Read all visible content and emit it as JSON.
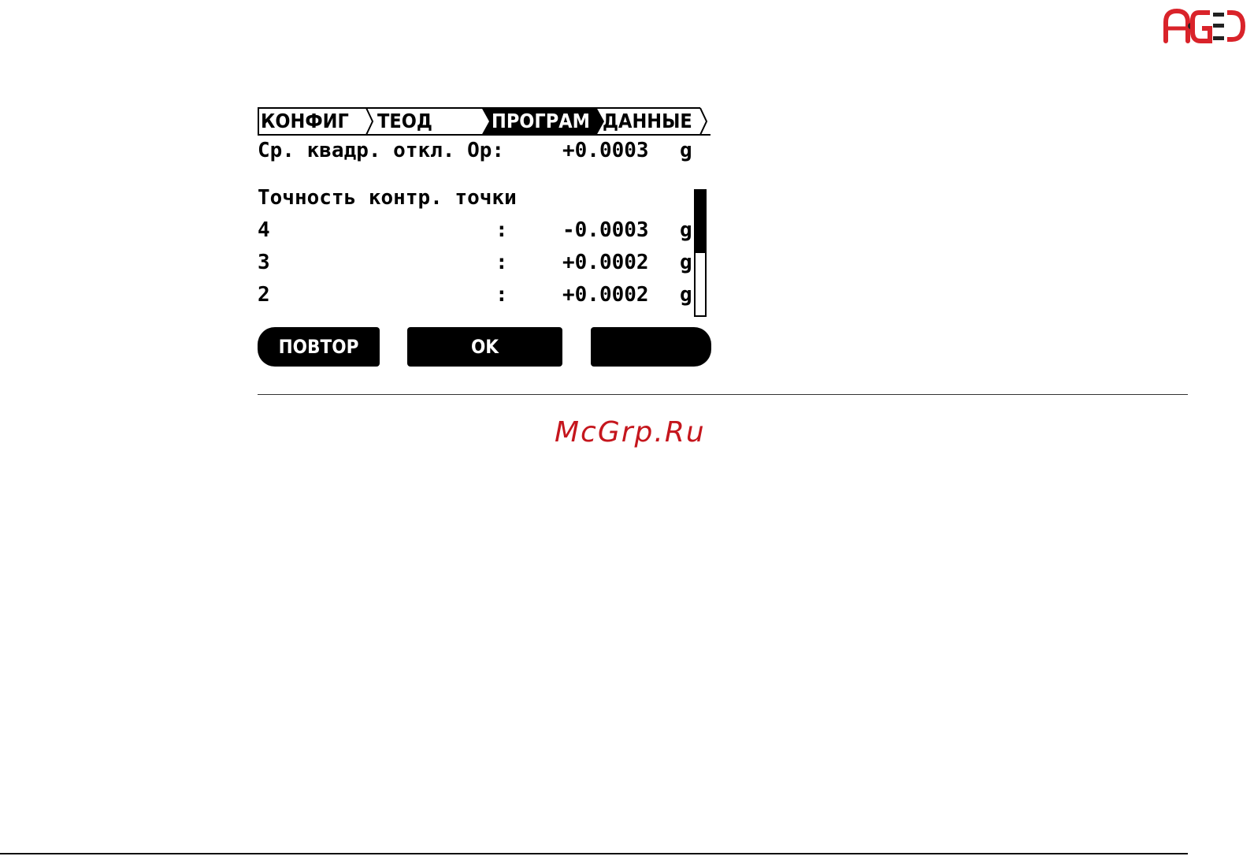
{
  "brand": {
    "logo_text": "AGED",
    "logo_color": "#d9232a"
  },
  "screen": {
    "tabs": [
      {
        "label": "КОНФИГ",
        "active": false
      },
      {
        "label": "ТЕОД",
        "active": false
      },
      {
        "label": "ПРОГРАМ",
        "active": true
      },
      {
        "label": "ДАННЫЕ",
        "active": false
      }
    ],
    "rmse": {
      "label": "Ср. квадр. откл. Ор:",
      "value": "+0.0003",
      "unit": "g"
    },
    "control_section_title": "Точность контр. точки",
    "control_points": [
      {
        "id": "4",
        "sep": ":",
        "value": "-0.0003",
        "unit": "g"
      },
      {
        "id": "3",
        "sep": ":",
        "value": "+0.0002",
        "unit": "g"
      },
      {
        "id": "2",
        "sep": ":",
        "value": "+0.0002",
        "unit": "g"
      }
    ],
    "scroll_position": 0.5,
    "softkeys": {
      "left": "ПОВТОР",
      "middle": "OK",
      "right": ""
    }
  },
  "watermark": "McGrp.Ru",
  "colors": {
    "accent_red": "#c5161d",
    "display_fg": "#000000",
    "display_bg": "#ffffff"
  }
}
